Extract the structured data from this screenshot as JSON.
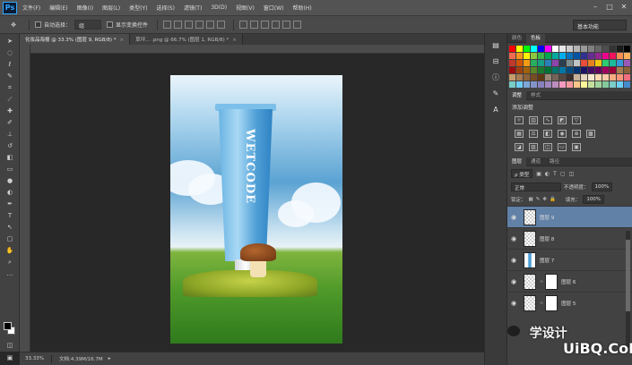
{
  "app": {
    "logo": "Ps"
  },
  "menu": [
    "文件(F)",
    "编辑(E)",
    "图像(I)",
    "图层(L)",
    "类型(Y)",
    "选择(S)",
    "滤镜(T)",
    "3D(D)",
    "视图(V)",
    "窗口(W)",
    "帮助(H)"
  ],
  "window_buttons": [
    "–",
    "□",
    "✕"
  ],
  "options": {
    "auto_select_label": "自动选择：",
    "auto_select_value": "组",
    "show_transform_label": "显示变换控件",
    "workspace": "基本功能"
  },
  "tabs": [
    {
      "label": "化妆品海报 @ 33.3% (图层 9, RGB/8) *",
      "close": "×"
    },
    {
      "label": "草坪... .png @ 66.7% (图层 1, RGB/8) *",
      "close": "×"
    }
  ],
  "document": {
    "tube_text": "WETCODE"
  },
  "status": {
    "zoom": "33.33%",
    "doc": "文档:4.39M/16.7M"
  },
  "panels": {
    "color_tabs": [
      "颜色",
      "色板"
    ],
    "adj_tabs": [
      "调整",
      "样式"
    ],
    "adj_title": "添加调整",
    "layers_tabs": [
      "图层",
      "通道",
      "路径"
    ],
    "kind_filter": "ρ 类型",
    "blend_mode": "正常",
    "opacity_label": "不透明度：",
    "opacity_value": "100%",
    "lock_label": "锁定：",
    "fill_label": "填充：",
    "fill_value": "100%",
    "layers": [
      {
        "name": "图层 9",
        "selected": true
      },
      {
        "name": "图层 8",
        "selected": false
      },
      {
        "name": "图层 7",
        "selected": false
      },
      {
        "name": "图层 6",
        "selected": false
      },
      {
        "name": "图层 5",
        "selected": false
      }
    ]
  },
  "watermark": {
    "line1": " 学设计",
    "line2": "UiBQ.CoM"
  },
  "swatch_colors": [
    "#ff0000",
    "#ffff00",
    "#00ff00",
    "#00ffff",
    "#0000ff",
    "#ff00ff",
    "#ffffff",
    "#e6e6e6",
    "#cccccc",
    "#b3b3b3",
    "#999999",
    "#808080",
    "#666666",
    "#4d4d4d",
    "#333333",
    "#1a1a1a",
    "#000000",
    "#f26c4f",
    "#f7941d",
    "#fff200",
    "#8dc63f",
    "#39b54a",
    "#00a651",
    "#00a99d",
    "#00aeef",
    "#0072bc",
    "#0054a6",
    "#2e3192",
    "#662d91",
    "#92278f",
    "#ec008c",
    "#ed145b",
    "#f68e56",
    "#fbaf5d",
    "#c0392b",
    "#d35400",
    "#f39c12",
    "#27ae60",
    "#16a085",
    "#2980b9",
    "#8e44ad",
    "#2c3e50",
    "#7f8c8d",
    "#bdc3c7",
    "#e74c3c",
    "#e67e22",
    "#f1c40f",
    "#2ecc71",
    "#1abc9c",
    "#3498db",
    "#9b59b6",
    "#9e0b0f",
    "#a0410d",
    "#a3620a",
    "#598527",
    "#1a7b30",
    "#007236",
    "#00746b",
    "#0076a3",
    "#004b80",
    "#003471",
    "#1b1464",
    "#440e62",
    "#630460",
    "#9e005d",
    "#9e0039",
    "#a67c52",
    "#8c6239",
    "#c69c6d",
    "#a67c52",
    "#8c6239",
    "#754c24",
    "#603913",
    "#998675",
    "#736357",
    "#534741",
    "#362f2d",
    "#c7b299",
    "#e5d6c0",
    "#f7e8d0",
    "#ffd8b1",
    "#fcc9a7",
    "#f9ad81",
    "#f69679",
    "#f26d7d",
    "#7accc8",
    "#6dcff6",
    "#7da7d9",
    "#8393ca",
    "#8781bd",
    "#a187be",
    "#bd8cbf",
    "#f49ac1",
    "#f5989d",
    "#fdc689",
    "#fff799",
    "#c4df9b",
    "#a3d39c",
    "#82ca9c",
    "#7accc8",
    "#6ecff6",
    "#448ccb"
  ]
}
